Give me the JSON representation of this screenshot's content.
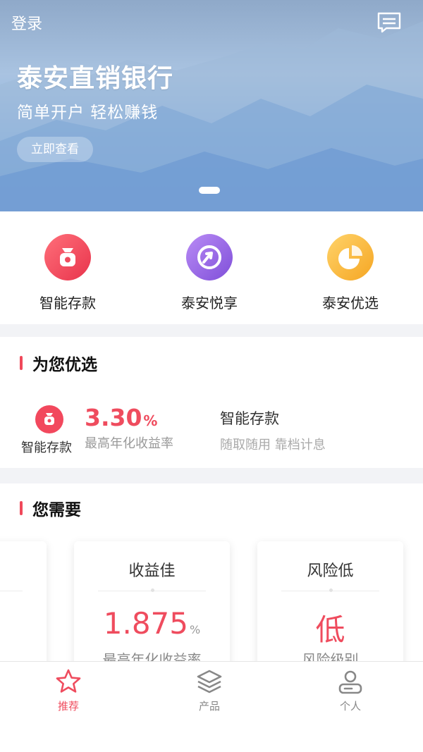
{
  "banner": {
    "login_label": "登录",
    "message_icon": "message-icon",
    "title": "泰安直销银行",
    "subtitle": "简单开户 轻松赚钱",
    "cta_label": "立即查看"
  },
  "quick_entries": [
    {
      "label": "智能存款",
      "icon": "money-bag-icon",
      "color": "#f2485d"
    },
    {
      "label": "泰安悦享",
      "icon": "rising-arrow-icon",
      "color": "#9a63e6"
    },
    {
      "label": "泰安优选",
      "icon": "pie-chart-icon",
      "color": "#f7b733"
    }
  ],
  "recommend": {
    "section_title": "为您优选",
    "product_icon_label": "智能存款",
    "rate_value": "3.30",
    "rate_unit": "%",
    "rate_label": "最高年化收益率",
    "product_name": "智能存款",
    "product_desc": "随取随用 靠档计息"
  },
  "needs": {
    "section_title": "您需要",
    "cards": [
      {
        "title": "",
        "value": "",
        "unit": "",
        "label": ""
      },
      {
        "title": "收益佳",
        "value": "1.875",
        "unit": "%",
        "label": "最高年化收益率"
      },
      {
        "title": "风险低",
        "value": "低",
        "unit": "",
        "label": "风险级别"
      }
    ]
  },
  "tabbar": {
    "items": [
      {
        "label": "推荐",
        "icon": "star-icon",
        "active": true
      },
      {
        "label": "产品",
        "icon": "layers-icon",
        "active": false
      },
      {
        "label": "个人",
        "icon": "person-icon",
        "active": false
      }
    ]
  },
  "colors": {
    "accent": "#ef4c5e",
    "divider_bg": "#f2f3f6"
  }
}
